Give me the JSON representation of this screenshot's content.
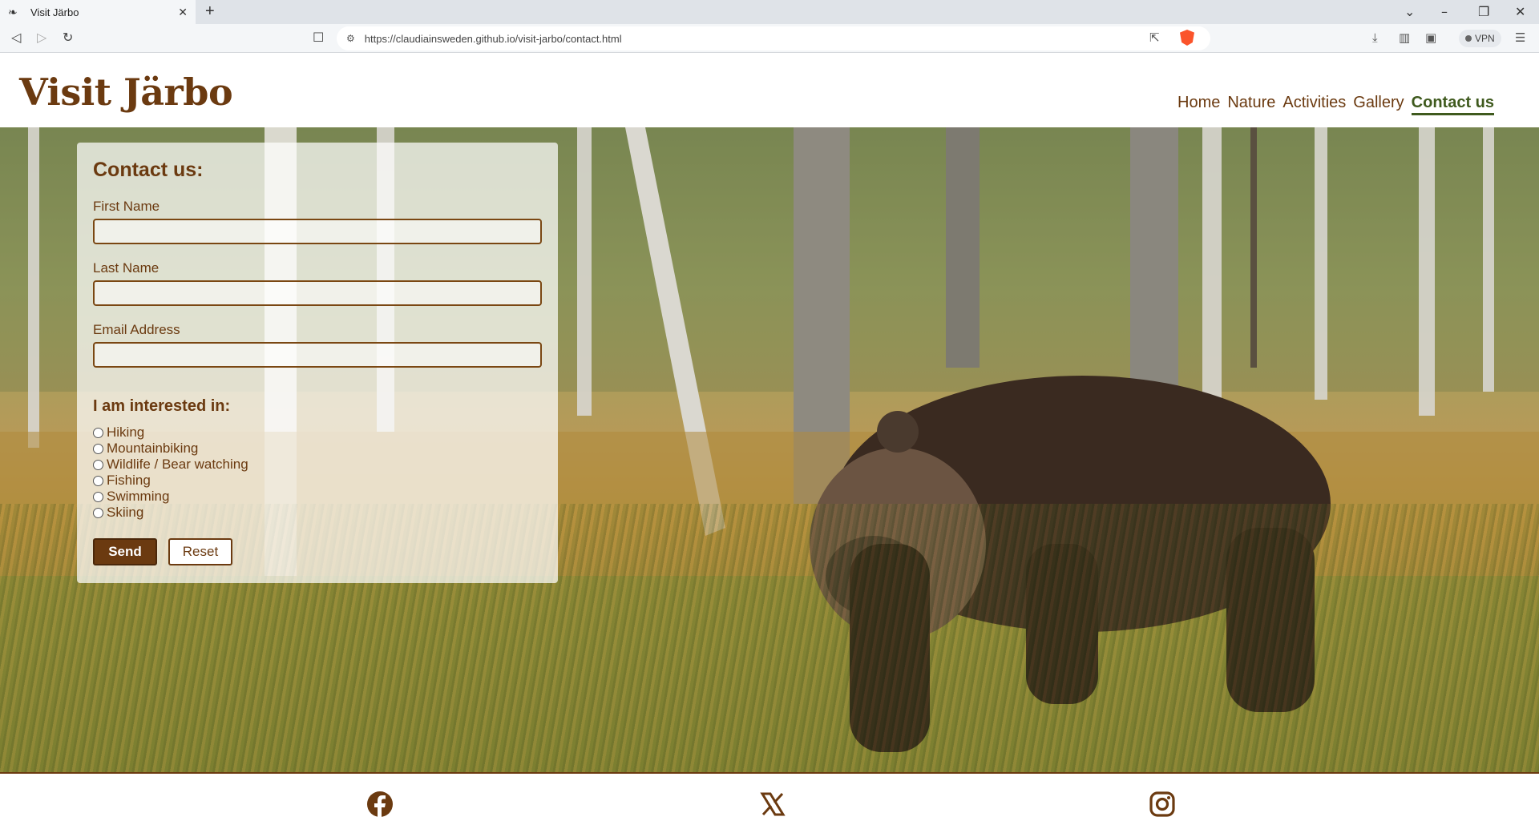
{
  "browser": {
    "tab_title": "Visit Järbo",
    "url": "https://claudiainsweden.github.io/visit-jarbo/contact.html",
    "vpn_label": "VPN"
  },
  "site": {
    "logo": "Visit Järbo",
    "nav": [
      {
        "label": "Home",
        "active": false
      },
      {
        "label": "Nature",
        "active": false
      },
      {
        "label": "Activities",
        "active": false
      },
      {
        "label": "Gallery",
        "active": false
      },
      {
        "label": "Contact us",
        "active": true
      }
    ]
  },
  "form": {
    "title": "Contact us:",
    "fields": [
      {
        "label": "First Name",
        "value": ""
      },
      {
        "label": "Last Name",
        "value": ""
      },
      {
        "label": "Email Address",
        "value": ""
      }
    ],
    "interest_title": "I am interested in:",
    "options": [
      "Hiking",
      "Mountainbiking",
      "Wildlife / Bear watching",
      "Fishing",
      "Swimming",
      "Skiing"
    ],
    "send_label": "Send",
    "reset_label": "Reset"
  },
  "footer": {
    "icons": [
      "facebook-icon",
      "x-icon",
      "instagram-icon"
    ]
  },
  "colors": {
    "brand_brown": "#6b3a10",
    "active_green": "#3f5a1e"
  }
}
